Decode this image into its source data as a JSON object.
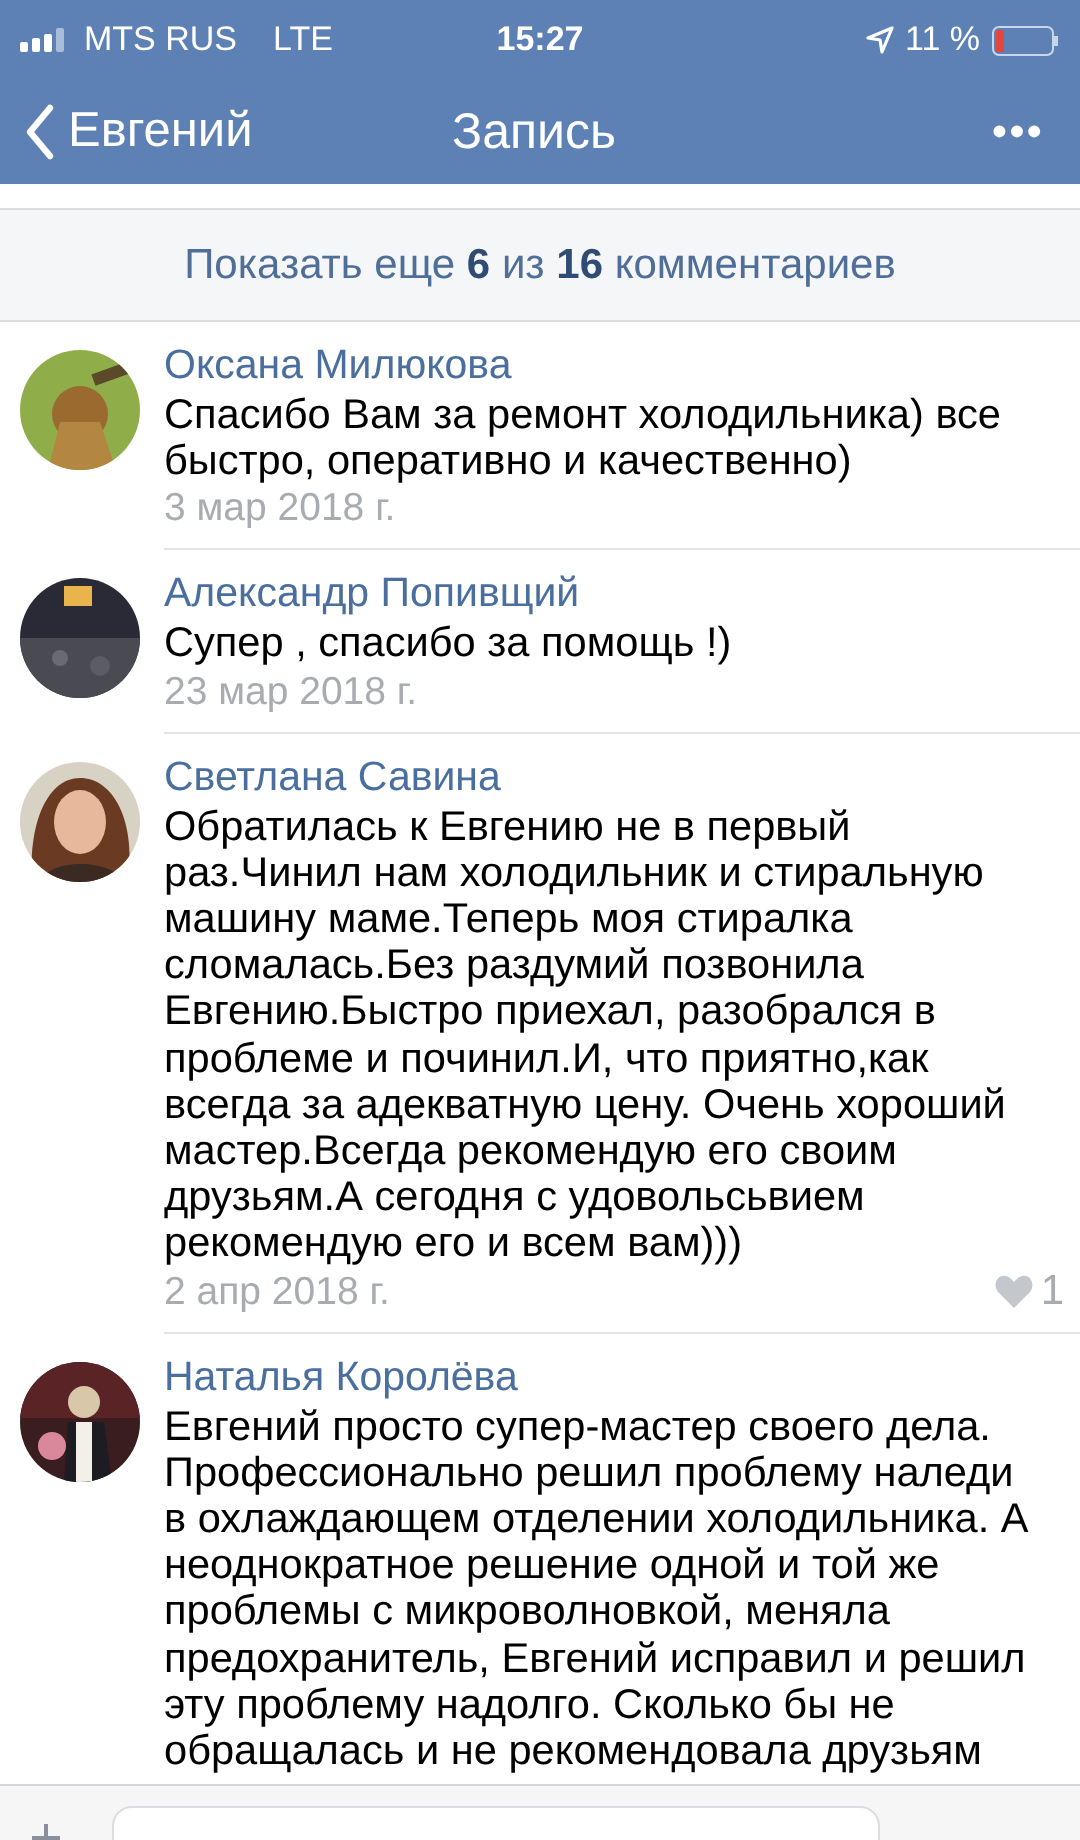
{
  "status_bar": {
    "carrier": "MTS RUS",
    "network": "LTE",
    "time": "15:27",
    "battery": "11 %"
  },
  "nav_bar": {
    "back": "Евгений",
    "title": "Запись",
    "menu": "•••"
  },
  "show_more": "Показать еще **6** из **16** комментариев",
  "comments": [
    {
      "author": "Оксана Милюкова",
      "text": "Спасибо Вам за ремонт холодильника) все быстро, оперативно и качественно)",
      "date": "3 мар 2018 г."
    },
    {
      "author": "Александр Попивщий",
      "text": "Супер , спасибо за помощь !)",
      "date": "23 мар 2018 г."
    },
    {
      "author": "Светлана Савина",
      "text": "Обратилась к Евгению не в первый раз.Чинил нам холодильник и стиральную машину маме.Теперь моя стиралка сломалась.Без раздумий позвонила Евгению.Быстро приехал, разобрался в проблеме и починил.И, что приятно,как всегда за адекватную цену. Очень хороший мастер.Всегда рекомендую его своим друзьям.А сегодня с удовольсьвием рекомендую его и всем  вам)))",
      "date": "2 апр 2018 г.",
      "likes": "1"
    },
    {
      "author": "Наталья Королёва",
      "text": "Евгений просто супер-мастер своего дела. Профессионально решил проблему наледи в охлаждающем отделении холодильника. А неоднократное решение одной и той же проблемы с микроволновкой, меняла предохранитель, Евгений исправил и решил эту проблему надолго. Сколько бы не обращалась и не рекомендовала друзьям"
    }
  ]
}
